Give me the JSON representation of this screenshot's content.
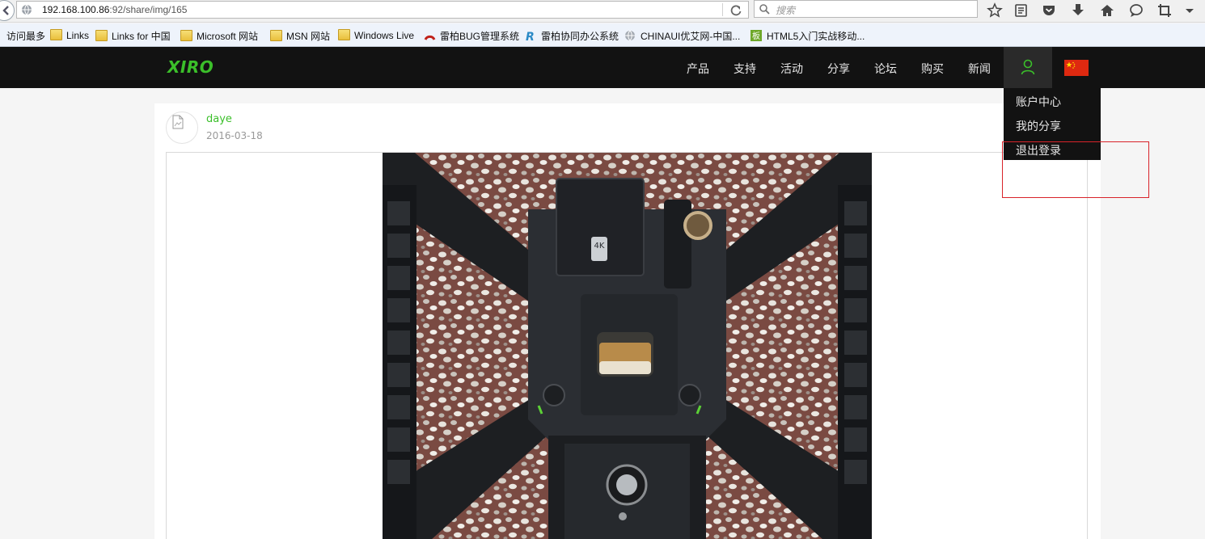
{
  "browser": {
    "url_host": "192.168.100.86",
    "url_rest": ":92/share/img/165",
    "search_placeholder": "搜索"
  },
  "bookmarks": [
    {
      "label": "访问最多",
      "icon": "none"
    },
    {
      "label": "Links",
      "icon": "folder-icon"
    },
    {
      "label": "Links for 中国",
      "icon": "folder-icon"
    },
    {
      "label": "Microsoft 网站",
      "icon": "folder-icon"
    },
    {
      "label": "MSN 网站",
      "icon": "folder-icon"
    },
    {
      "label": "Windows Live",
      "icon": "folder-icon"
    },
    {
      "label": "雷柏BUG管理系统",
      "icon": "bug-tracker-icon"
    },
    {
      "label": "雷柏协同办公系统",
      "icon": "office-system-icon"
    },
    {
      "label": "CHINAUI优艾网-中国...",
      "icon": "globe-icon"
    },
    {
      "label": "HTML5入门实战移动...",
      "icon": "site-icon"
    }
  ],
  "site": {
    "logo": "XIRO",
    "nav": [
      "产品",
      "支持",
      "活动",
      "分享",
      "论坛",
      "购买",
      "新闻"
    ],
    "accent_color": "#3bbf2a"
  },
  "user_menu": {
    "items": [
      "账户中心",
      "我的分享",
      "退出登录"
    ]
  },
  "post": {
    "username": "daye",
    "date": "2016-03-18",
    "photo_badge": "4K"
  }
}
